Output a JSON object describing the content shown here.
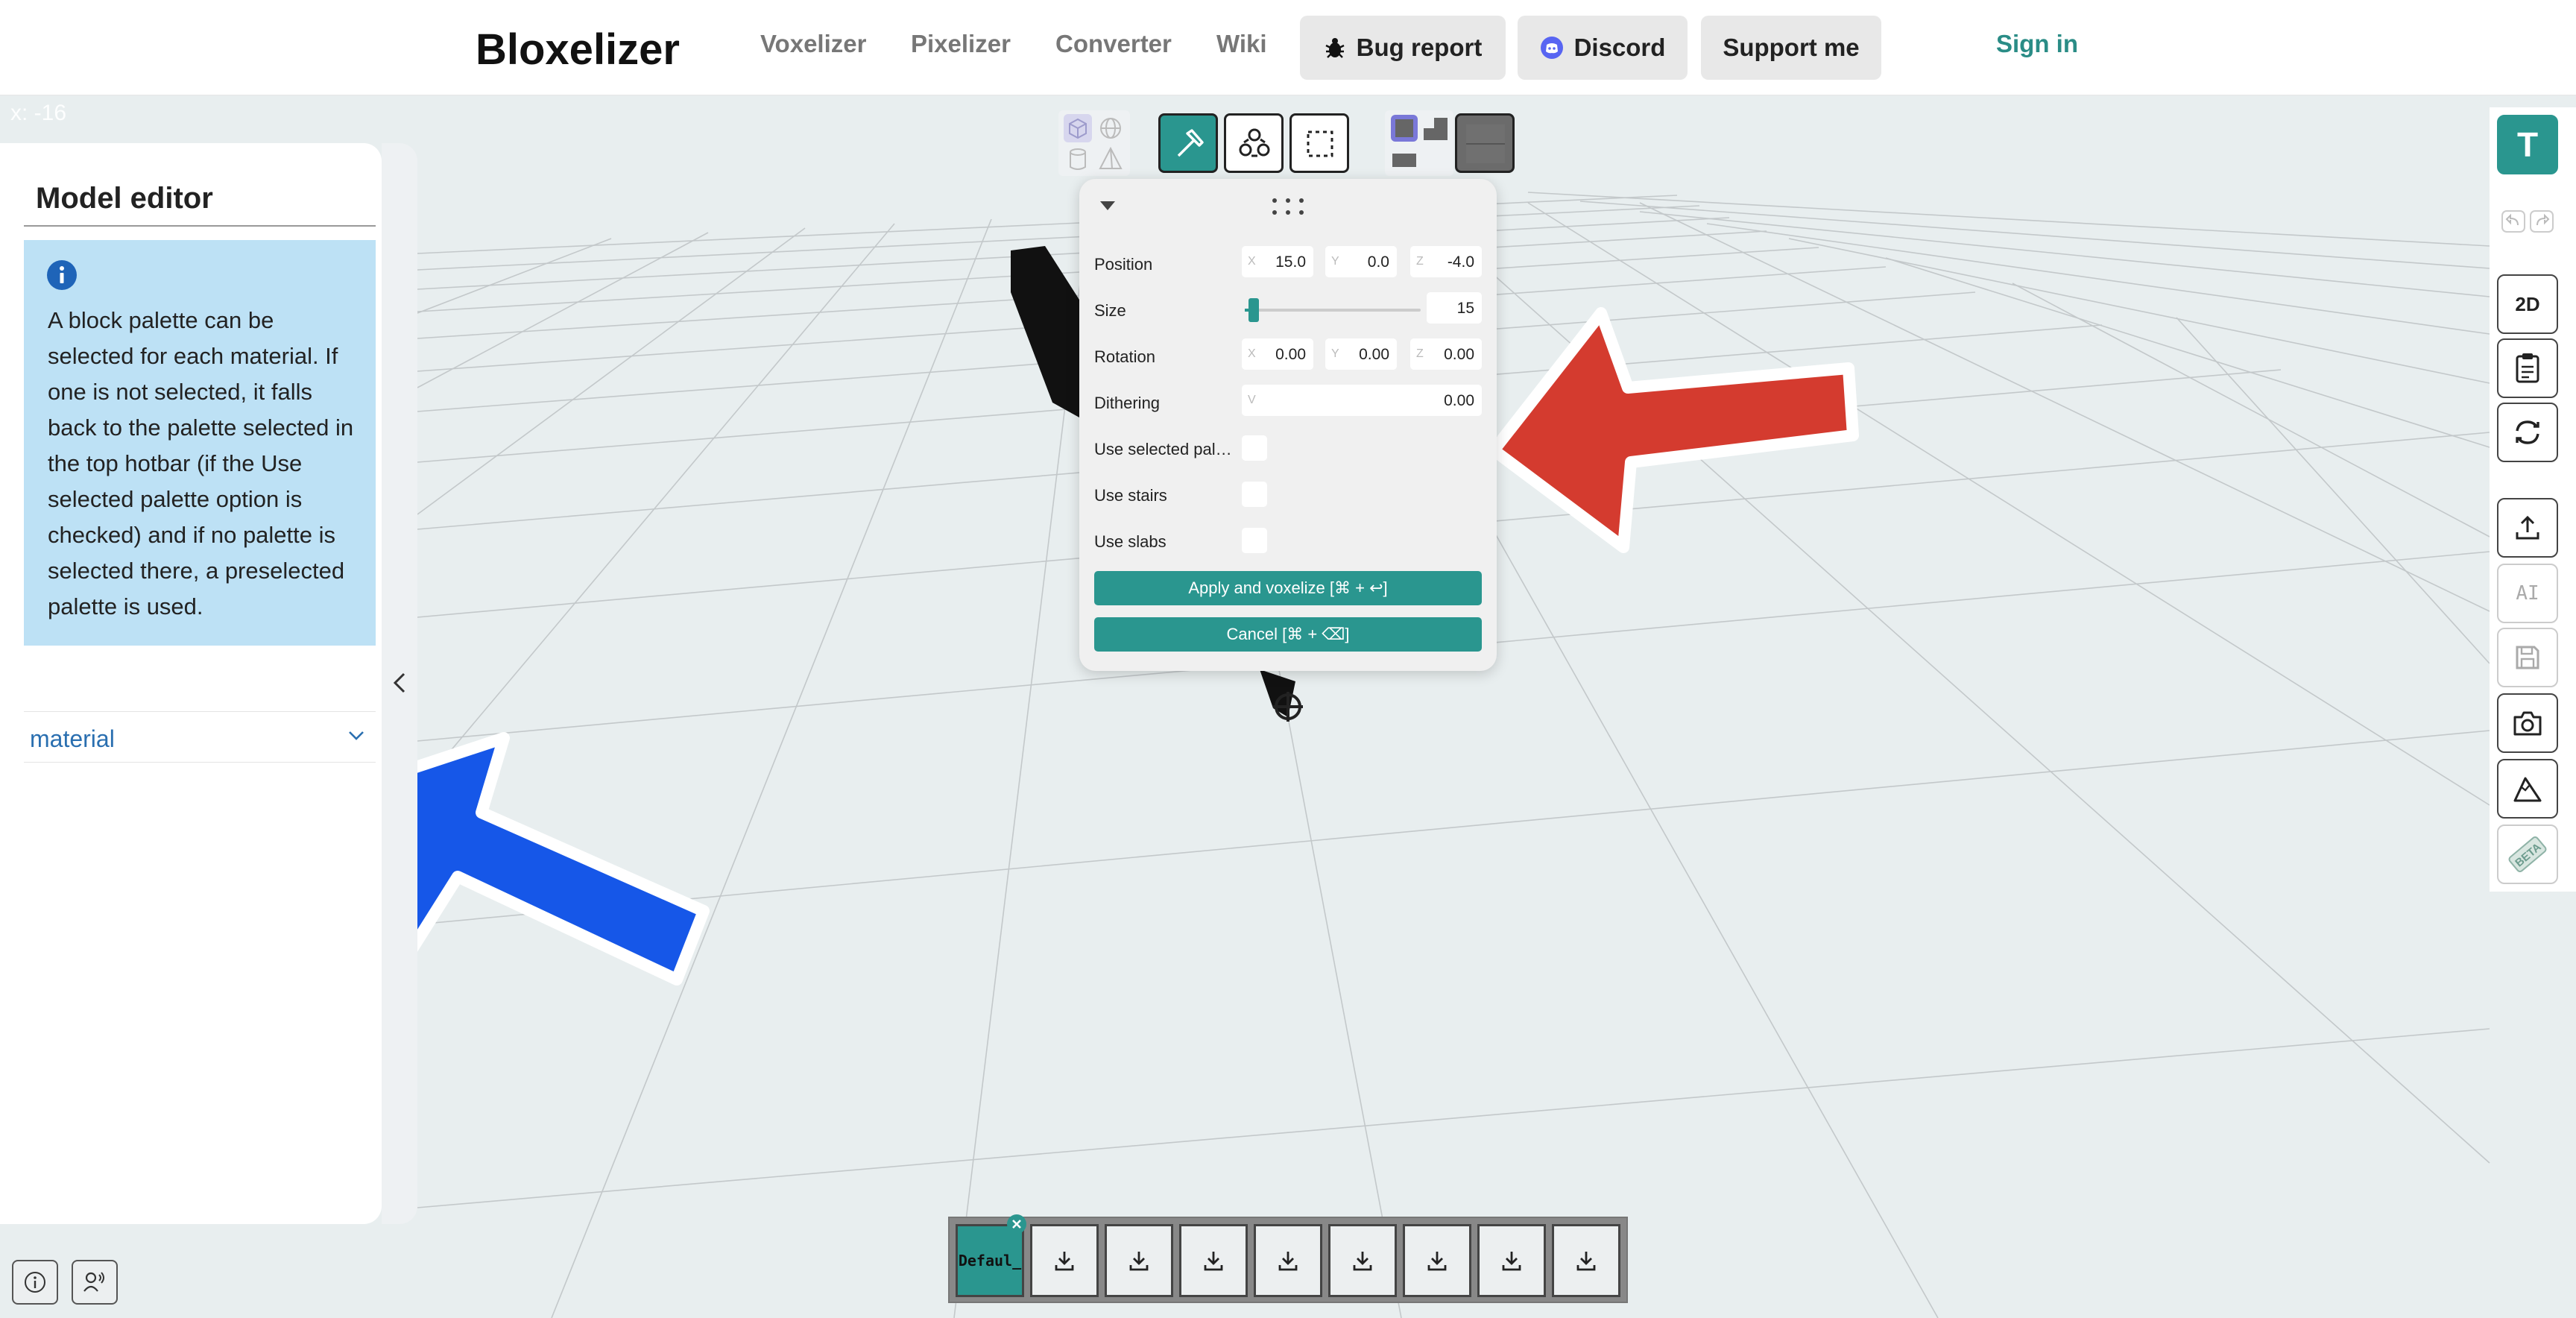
{
  "nav": {
    "logo": "Bloxelizer",
    "links": [
      "Voxelizer",
      "Pixelizer",
      "Converter",
      "Wiki"
    ],
    "bug_report": "Bug report",
    "discord": "Discord",
    "support": "Support me",
    "sign_in": "Sign in"
  },
  "coord_readout": "x: -16",
  "left_panel": {
    "title": "Model editor",
    "info_text": "A block palette can be selected for each material. If one is not selected, it falls back to the palette selected in the top hotbar (if the Use selected palette option is checked) and if no palette is selected there, a preselected palette is used.",
    "material_label": "material"
  },
  "toolbar": {
    "icons": [
      "cube-view-icon",
      "sphere-view-icon",
      "cylinder-view-icon",
      "pyramid-view-icon",
      "hammer-icon",
      "shapes-icon",
      "selection-icon",
      "block-full-icon",
      "block-stairs-icon",
      "block-slab-icon",
      "gray-block-icon"
    ]
  },
  "popup": {
    "position_label": "Position",
    "position": {
      "x_axis": "X",
      "x": "15.0",
      "y_axis": "Y",
      "y": "0.0",
      "z_axis": "Z",
      "z": "-4.0"
    },
    "size_label": "Size",
    "size_value": "15",
    "size_fraction": 0.05,
    "rotation_label": "Rotation",
    "rotation": {
      "x_axis": "X",
      "x": "0.00",
      "y_axis": "Y",
      "y": "0.00",
      "z_axis": "Z",
      "z": "0.00"
    },
    "dithering_label": "Dithering",
    "dithering_axis": "V",
    "dithering_value": "0.00",
    "use_selected_palette_label": "Use selected pal…",
    "use_stairs_label": "Use stairs",
    "use_slabs_label": "Use slabs",
    "apply_label": "Apply and voxelize [⌘ + ↩]",
    "cancel_label": "Cancel [⌘ + ⌫]"
  },
  "right_toolbar": {
    "text_tool": "T",
    "view_2d": "2D",
    "ai": "AI",
    "beta": "BETA"
  },
  "hotbar": {
    "active_slot_label": "Defaul_",
    "slot_count": 9
  },
  "colors": {
    "accent": "#2a968f",
    "info_bg": "#bde1f5",
    "arrow_red": "#d43b2f",
    "arrow_blue": "#1657e8",
    "canvas_bg": "#e8eeef"
  }
}
